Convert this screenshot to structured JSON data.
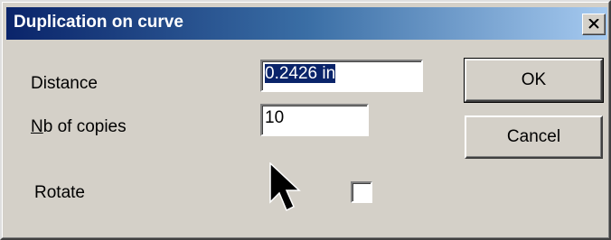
{
  "window": {
    "title": "Duplication on curve",
    "close_icon": "close-x-icon"
  },
  "form": {
    "distance_label": "Distance",
    "distance_value": "0.2426 in",
    "copies_label_mnemonic": "N",
    "copies_label_rest": "b of copies",
    "copies_value": "10",
    "rotate_label": "Rotate",
    "rotate_checked": false
  },
  "buttons": {
    "ok_label": "OK",
    "cancel_label": "Cancel"
  },
  "colors": {
    "title_gradient_start": "#0a246a",
    "title_gradient_end": "#a6caf0",
    "face": "#d4d0c8",
    "selection": "#0a246a"
  }
}
